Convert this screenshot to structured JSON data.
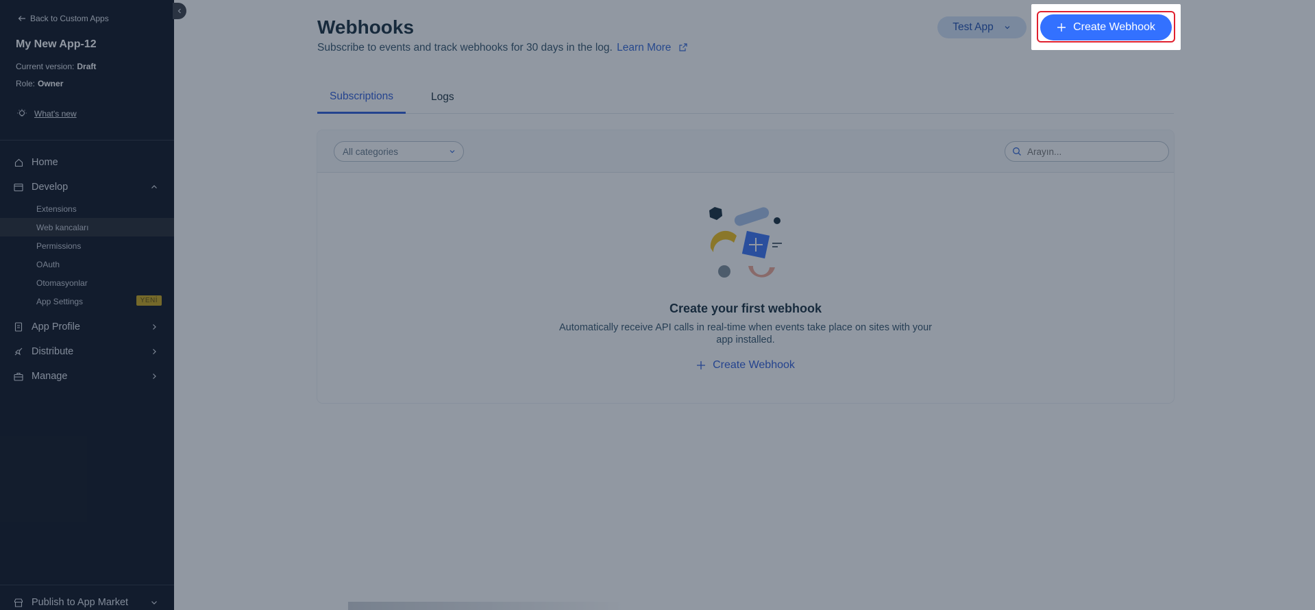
{
  "sidebar": {
    "back_label": "Back to Custom Apps",
    "app_name": "My New App-12",
    "version_label": "Current version:",
    "version_value": "Draft",
    "role_label": "Role:",
    "role_value": "Owner",
    "whats_new": "What's new",
    "nav": {
      "home": "Home",
      "develop": "Develop",
      "app_profile": "App Profile",
      "distribute": "Distribute",
      "manage": "Manage",
      "publish": "Publish to App Market"
    },
    "develop_items": [
      {
        "label": "Extensions"
      },
      {
        "label": "Web kancaları"
      },
      {
        "label": "Permissions"
      },
      {
        "label": "OAuth"
      },
      {
        "label": "Otomasyonlar"
      },
      {
        "label": "App Settings"
      }
    ],
    "new_badge": "YENİ"
  },
  "header": {
    "title": "Webhooks",
    "subtitle": "Subscribe to events and track webhooks for 30 days in the log.",
    "learn_more": "Learn More",
    "app_selector": "Test App",
    "create_button": "Create Webhook"
  },
  "tabs": [
    {
      "label": "Subscriptions"
    },
    {
      "label": "Logs"
    }
  ],
  "filters": {
    "category_value": "All categories",
    "search_placeholder": "Arayın..."
  },
  "empty_state": {
    "title": "Create your first webhook",
    "description": "Automatically receive API calls in real-time when events take place on sites with your app installed.",
    "cta": "Create Webhook"
  },
  "colors": {
    "accent": "#3371ff",
    "sidebar_bg": "#0c1220",
    "highlight_frame": "#e0202e",
    "badge": "#c9a51a"
  }
}
